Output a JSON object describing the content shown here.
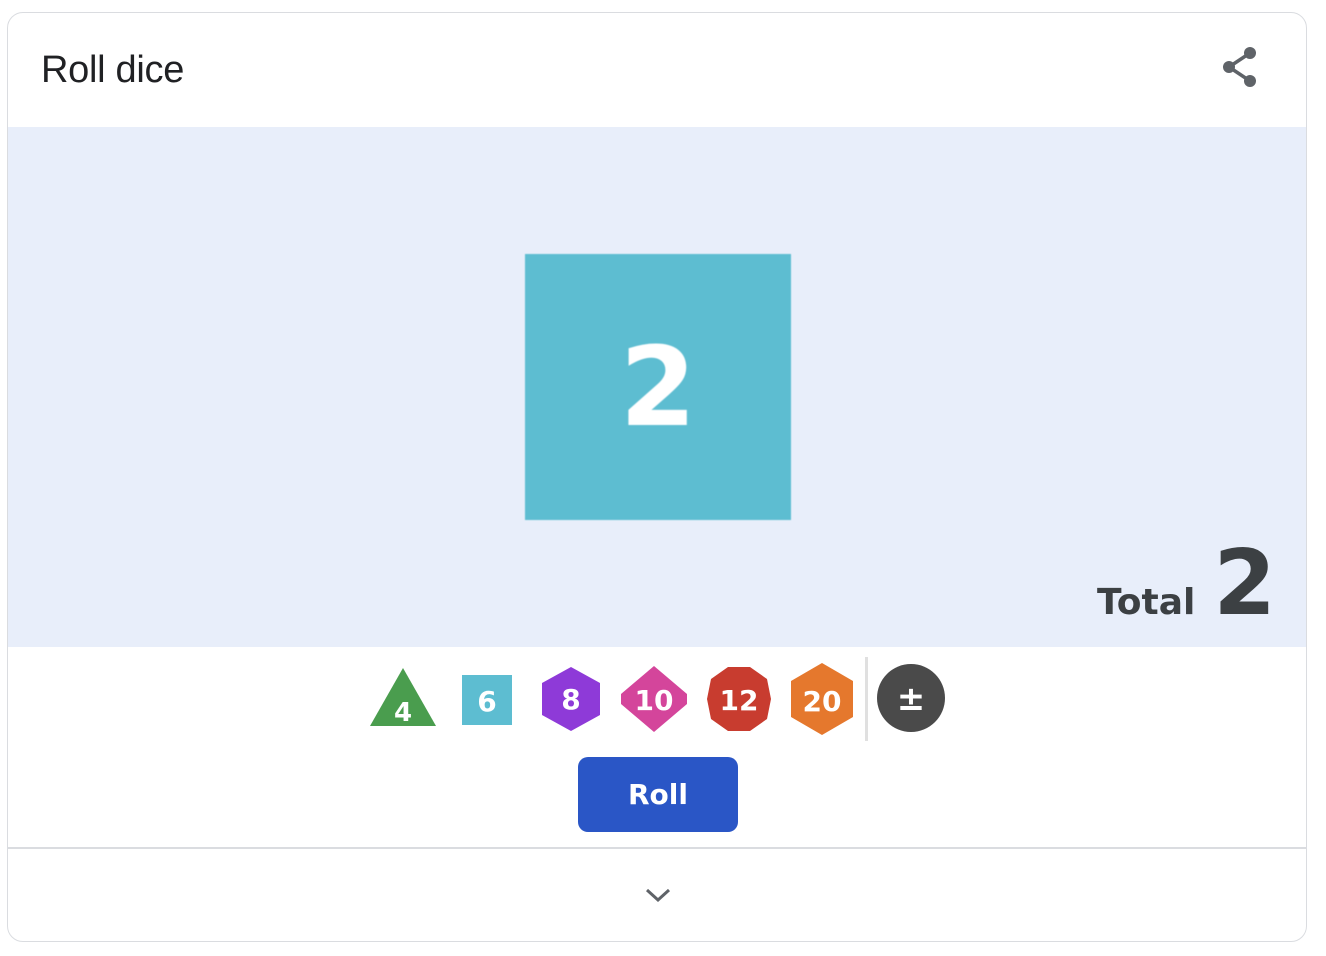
{
  "header": {
    "title": "Roll dice",
    "share_icon": "share-icon"
  },
  "result": {
    "die_face": "2",
    "die_color": "#5dbdd1",
    "total_label": "Total",
    "total_value": "2"
  },
  "dice": [
    {
      "label": "4",
      "shape": "triangle",
      "color": "#4a9d4e"
    },
    {
      "label": "6",
      "shape": "square",
      "color": "#5dbdd1"
    },
    {
      "label": "8",
      "shape": "hexagon",
      "color": "#8e3ad8"
    },
    {
      "label": "10",
      "shape": "diamond",
      "color": "#d4459b"
    },
    {
      "label": "12",
      "shape": "decagon",
      "color": "#c83c2f"
    },
    {
      "label": "20",
      "shape": "hexagon",
      "color": "#e5782d"
    },
    {
      "label": "±",
      "shape": "circle",
      "color": "#4a4a4a"
    }
  ],
  "actions": {
    "roll_label": "Roll",
    "roll_color": "#2a56c6"
  },
  "footer": {
    "expand_icon": "chevron-down-icon"
  },
  "colors": {
    "stage_bg": "#e8eefa",
    "text": "#202124"
  }
}
